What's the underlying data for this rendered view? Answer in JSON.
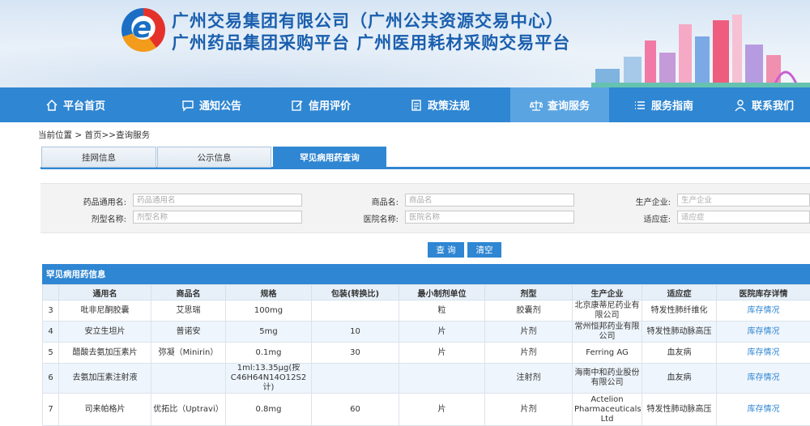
{
  "header": {
    "title_line1": "广州交易集团有限公司（广州公共资源交易中心）",
    "title_line2": "广州药品集团采购平台  广州医用耗材采购交易平台",
    "logo_letter": "e"
  },
  "nav": {
    "items": [
      {
        "label": "平台首页",
        "icon": "home-icon"
      },
      {
        "label": "通知公告",
        "icon": "chat-icon"
      },
      {
        "label": "信用评价",
        "icon": "edit-icon"
      },
      {
        "label": "政策法规",
        "icon": "document-icon"
      },
      {
        "label": "查询服务",
        "icon": "scale-icon",
        "active": true
      },
      {
        "label": "服务指南",
        "icon": "list-icon"
      },
      {
        "label": "联系我们",
        "icon": "user-icon"
      }
    ]
  },
  "breadcrumb": "当前位置 > 首页>>查询服务",
  "tabs": [
    {
      "label": "挂网信息"
    },
    {
      "label": "公示信息"
    },
    {
      "label": "罕见病用药查询",
      "active": true
    }
  ],
  "form": {
    "drug_name_label": "药品通用名:",
    "drug_name_placeholder": "药品通用名",
    "trade_name_label": "商品名:",
    "trade_name_placeholder": "商品名",
    "maker_label": "生产企业:",
    "maker_placeholder": "生产企业",
    "dosage_label": "剂型名称:",
    "dosage_placeholder": "剂型名称",
    "hospital_label": "医院名称:",
    "hospital_placeholder": "医院名称",
    "indication_label": "适应症:",
    "indication_placeholder": "适应症",
    "query_button": "查 询",
    "clear_button": "清空"
  },
  "table": {
    "title": "罕见病用药信息",
    "columns": [
      "",
      "通用名",
      "商品名",
      "规格",
      "包装(转换比)",
      "最小制剂单位",
      "剂型",
      "生产企业",
      "适应症",
      "医院库存详情"
    ],
    "rows": [
      {
        "no": "3",
        "generic": "吡非尼酮胶囊",
        "trade": "艾思瑞",
        "spec": "100mg",
        "pack": "",
        "unit": "粒",
        "form": "胶囊剂",
        "maker": "北京康蒂尼药业有限公司",
        "indication": "特发性肺纤维化",
        "stock": "库存情况"
      },
      {
        "no": "4",
        "generic": "安立生坦片",
        "trade": "普诺安",
        "spec": "5mg",
        "pack": "10",
        "unit": "片",
        "form": "片剂",
        "maker": "常州恒邦药业有限公司",
        "indication": "特发性肺动脉高压",
        "stock": "库存情况"
      },
      {
        "no": "5",
        "generic": "醋酸去氨加压素片",
        "trade": "弥凝（Minirin）",
        "spec": "0.1mg",
        "pack": "30",
        "unit": "片",
        "form": "片剂",
        "maker": "Ferring AG",
        "indication": "血友病",
        "stock": "库存情况"
      },
      {
        "no": "6",
        "generic": "去氨加压素注射液",
        "trade": "",
        "spec": "1ml:13.35μg(按C46H64N14O12S2计)",
        "pack": "",
        "unit": "",
        "form": "注射剂",
        "maker": "海南中和药业股份有限公司",
        "indication": "血友病",
        "stock": "库存情况"
      },
      {
        "no": "7",
        "generic": "司来帕格片",
        "trade": "优拓比（Uptravi）",
        "spec": "0.8mg",
        "pack": "60",
        "unit": "片",
        "form": "片剂",
        "maker": "Actelion Pharmaceuticals Ltd",
        "indication": "特发性肺动脉高压",
        "stock": "库存情况"
      }
    ]
  },
  "colors": {
    "primary": "#2f86d2",
    "nav_active": "#5aa4e2",
    "title": "#1a5fae",
    "row_alt": "#eef5fc"
  }
}
